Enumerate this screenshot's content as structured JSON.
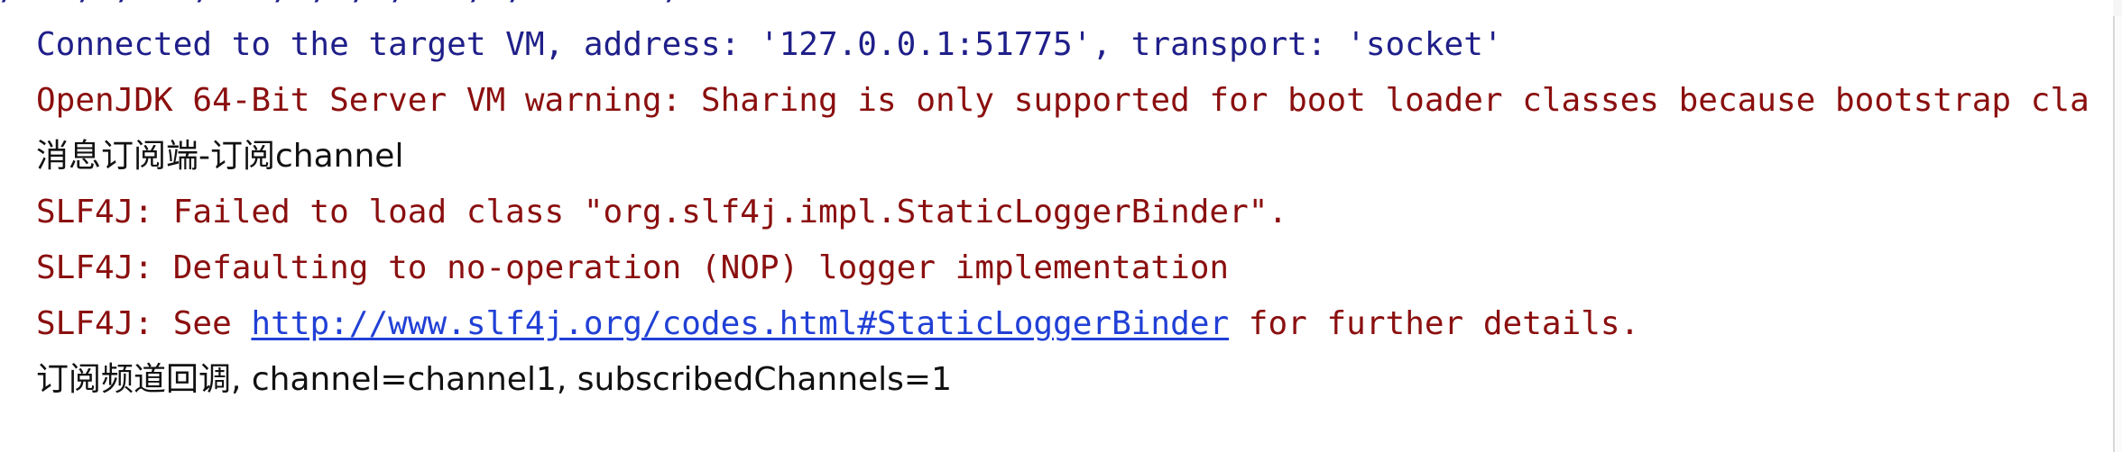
{
  "console": {
    "clipped_line": "/ · / / · / · / / / / · / / · · · / · · ·",
    "lines": [
      {
        "text": "Connected to the target VM, address: '127.0.0.1:51775', transport: 'socket'"
      },
      {
        "text": "OpenJDK 64-Bit Server VM warning: Sharing is only supported for boot loader classes because bootstrap cla"
      },
      {
        "text": "消息订阅端-订阅channel"
      },
      {
        "text": "SLF4J: Failed to load class \"org.slf4j.impl.StaticLoggerBinder\"."
      },
      {
        "text": "SLF4J: Defaulting to no-operation (NOP) logger implementation"
      },
      {
        "prefix": "SLF4J: See ",
        "link": "http://www.slf4j.org/codes.html#StaticLoggerBinder",
        "suffix": " for further details."
      },
      {
        "text": "订阅频道回调, channel=channel1, subscribedChannels=1"
      }
    ]
  },
  "colors": {
    "info": "#1f1f8a",
    "error": "#8b0f0f",
    "stdout": "#111111",
    "link": "#2140d6",
    "background": "#ffffff"
  }
}
